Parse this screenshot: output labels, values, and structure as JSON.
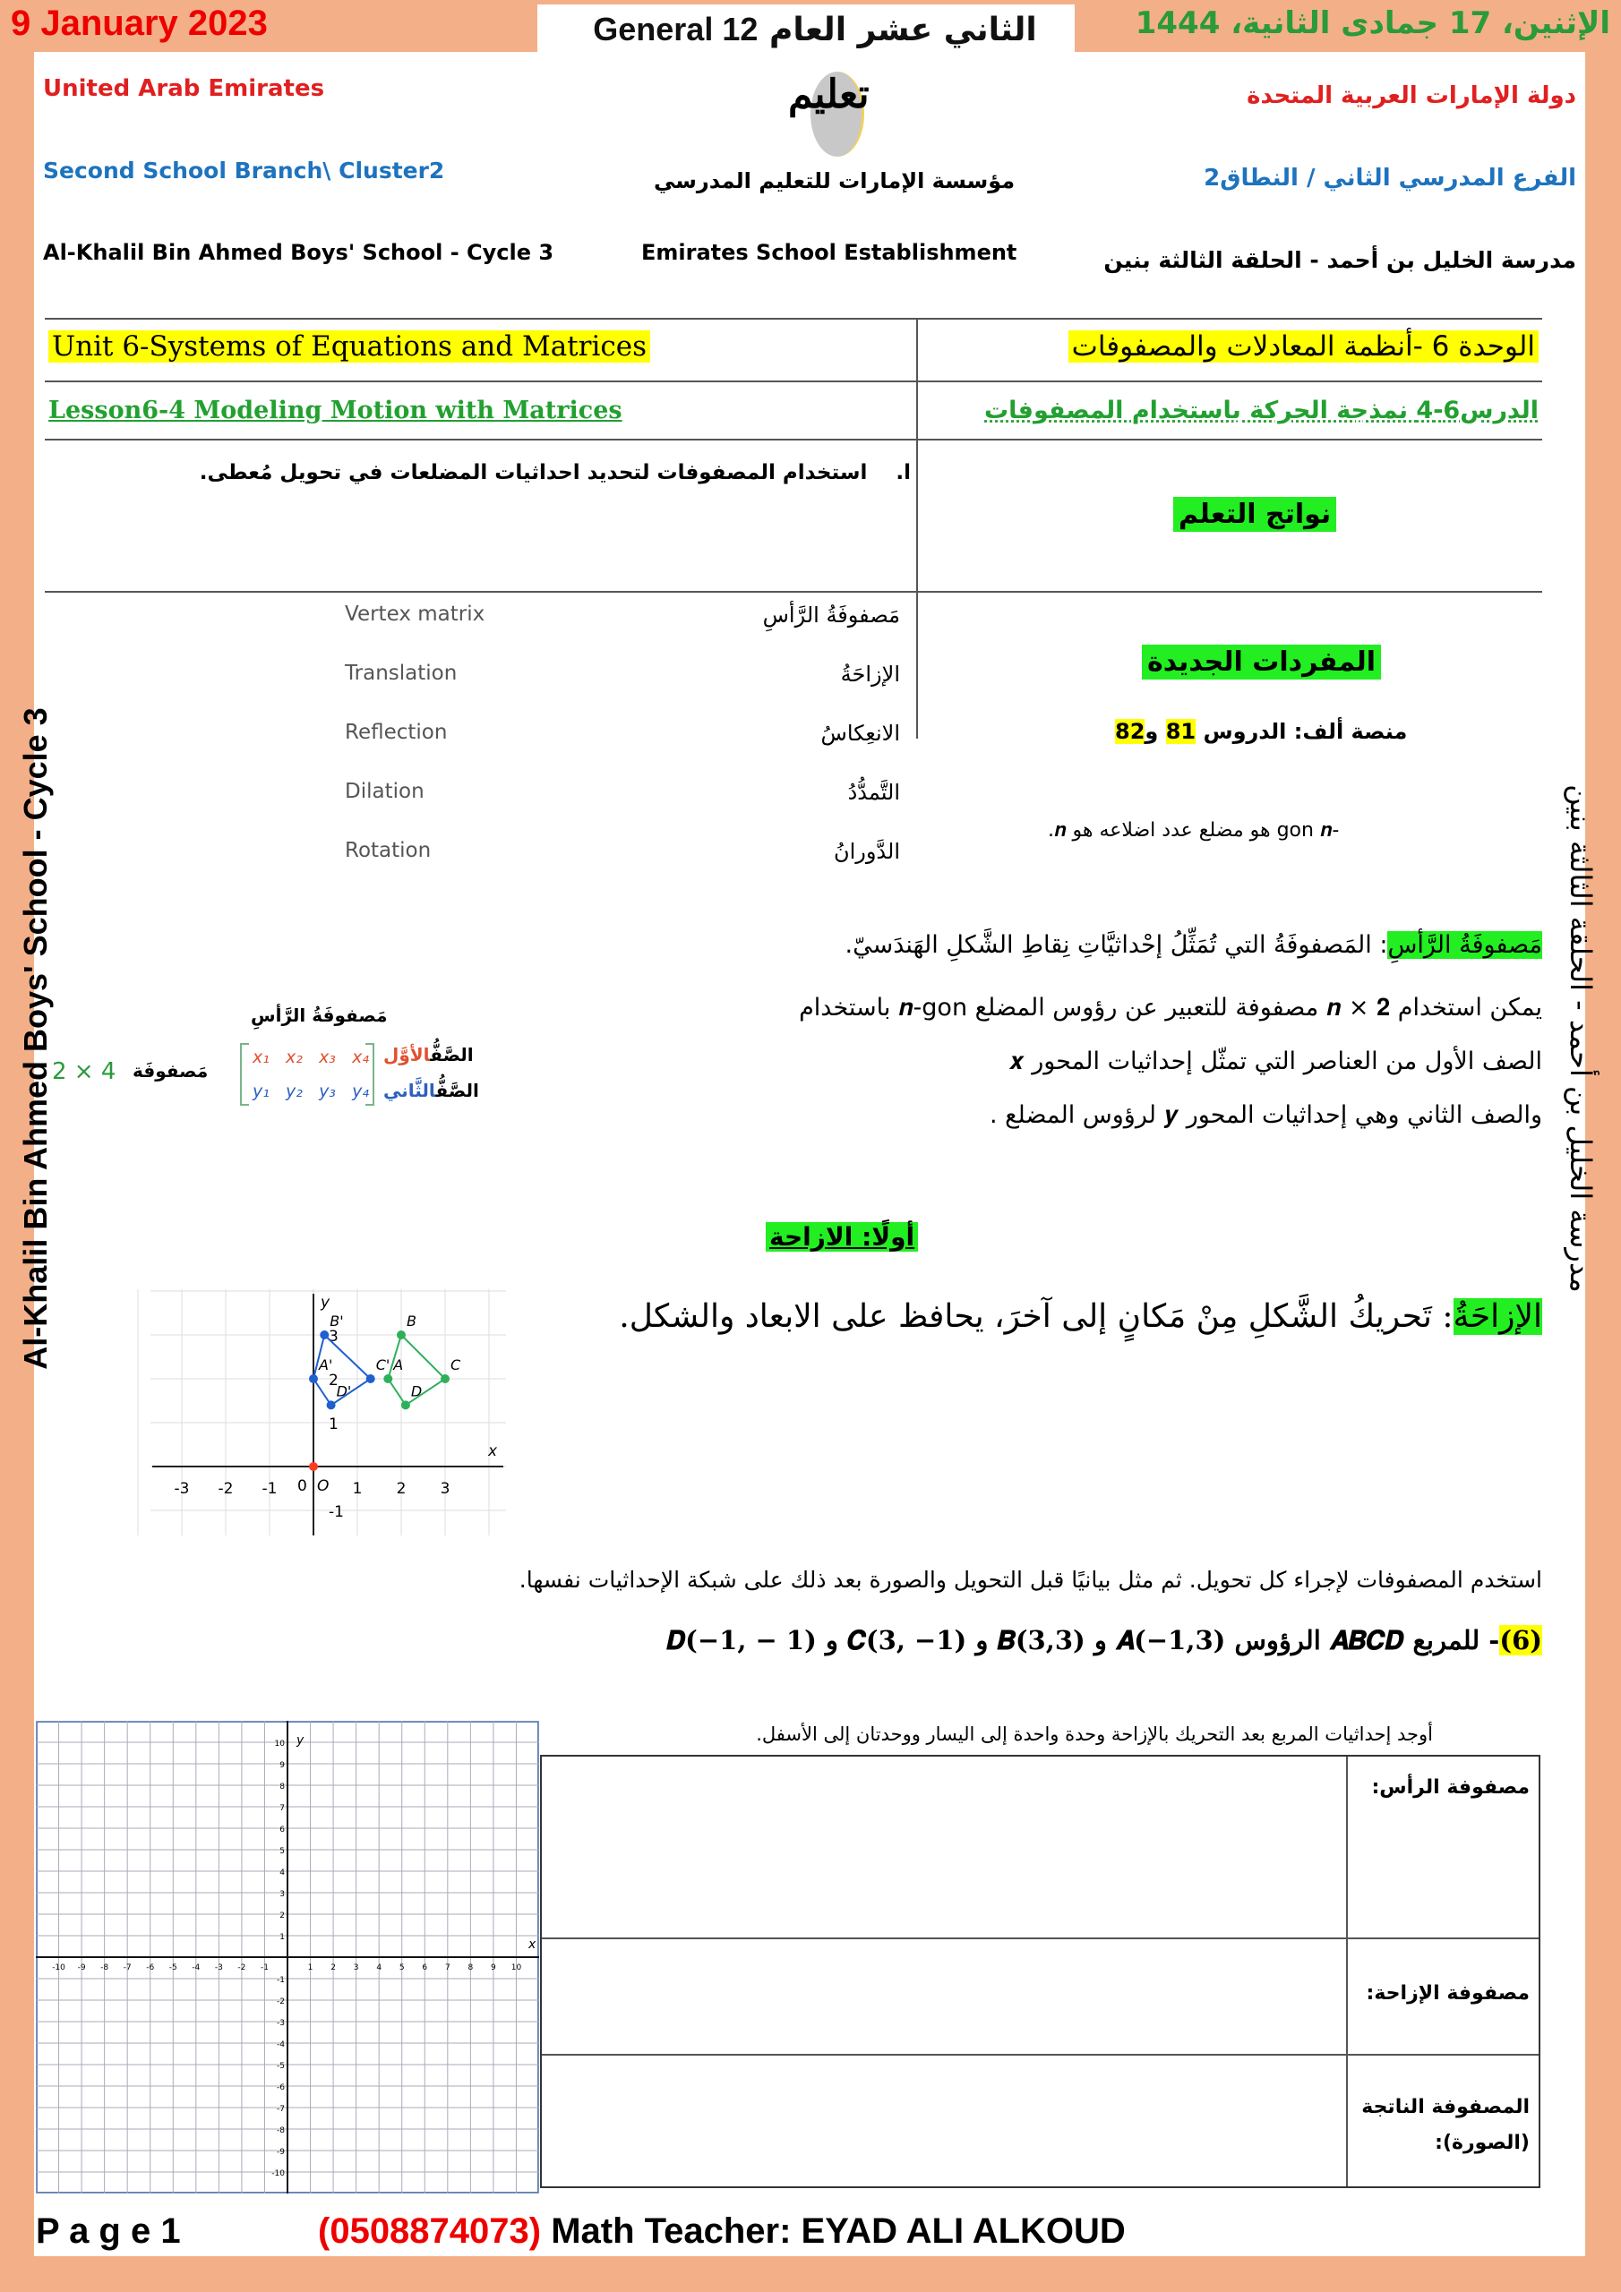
{
  "header": {
    "date_en": "9 January 2023",
    "grade": "12 General",
    "grade_ar": "الثاني عشر العام",
    "date_ar": "الإثنين، 17 جمادى الثانية، 1444",
    "country_en": "United Arab Emirates",
    "country_ar": "دولة الإمارات العربية المتحدة",
    "branch_en": "Second School Branch\\ Cluster2",
    "branch_ar": "الفرع المدرسي الثاني / النطاق2",
    "logo_text": "تعليم",
    "establishment_ar": "مؤسسة الإمارات للتعليم المدرسي",
    "school_en": "Al-Khalil Bin Ahmed Boys' School - Cycle 3",
    "establishment_en": "Emirates School Establishment",
    "school_ar": "مدرسة الخليل بن أحمد - الحلقة الثالثة بنين"
  },
  "side": {
    "left": "Al-Khalil Bin Ahmed Boys' School - Cycle 3",
    "right": "مدرسة الخليل بن أحمد - الحلقة الثالثة بنين"
  },
  "info_table": {
    "unit_en": "Unit 6-Systems of Equations and Matrices",
    "unit_ar": "الوحدة 6 -أنظمة المعادلات والمصفوفات",
    "lesson_en": "Lesson6-4 Modeling Motion with Matrices",
    "lesson_ar": "الدرس6-4 نمذجة الحركة باستخدام المصفوفات",
    "outcome_num": "ا.",
    "outcome": "استخدام المصفوفات لتحديد احداثيات المضلعات في تحويل مُعطى.",
    "outcomes_label": "نواتج التعلم",
    "vocab_label": "المفردات الجديدة",
    "platform_prefix": "منصة ألف: الدروس",
    "lesson_a": "81",
    "and": "و",
    "lesson_b": "82",
    "ngon": "-gon 𝒏 هو مضلع عدد اضلاعه هو 𝒏.",
    "vocab": [
      {
        "en": "Vertex matrix",
        "ar": "مَصفوفَةُ الرَّأسِ"
      },
      {
        "en": "Translation",
        "ar": "الإزاحَةُ"
      },
      {
        "en": "Reflection",
        "ar": "الانعِكاسُ"
      },
      {
        "en": "Dilation",
        "ar": "التَّمدُّدُ"
      },
      {
        "en": "Rotation",
        "ar": "الدَّورانُ"
      }
    ]
  },
  "vertex": {
    "term": "مَصفوفَةُ الرَّأسِ",
    "def": ": المَصفوفَةُ التي تُمَثِّلُ إحْداثيَّاتِ نِقاطِ الشَّكلِ الهَندَسيّ.",
    "line1": "يمكن استخدام 𝒏 × 𝟐 مصفوفة للتعبير عن رؤوس المضلع 𝒏-gon باستخدام",
    "line2": "الصف الأول من العناصر التي تمثّل إحداثيات المحور 𝒙",
    "line3": "والصف الثاني وهي إحداثيات المحور 𝒚 لرؤوس المضلع ."
  },
  "matrix": {
    "title": "مَصفوفَةُ الرَّأسِ",
    "row1_a": "الصَّفُّ",
    "row1_b": "الأوَّل",
    "row2_a": "الصَّفُّ",
    "row2_b": "الثَّاني",
    "size_label": "مَصفوفَة",
    "size": "2 × 4",
    "row1": [
      "x₁",
      "x₂",
      "x₃",
      "x₄"
    ],
    "row2": [
      "y₁",
      "y₂",
      "y₃",
      "y₄"
    ]
  },
  "translation": {
    "heading": "أولًا: الازاحة",
    "term": "الإزاحَةُ",
    "def": ": تَحريكُ الشَّكلِ مِنْ مَكانٍ إلى آخرَ، يحافظ على الابعاد والشكل."
  },
  "figure": {
    "x_ticks": [
      "-3",
      "-2",
      "-1",
      "1",
      "2",
      "3"
    ],
    "y_ticks": [
      "3",
      "2",
      "1",
      "-1"
    ],
    "origin": "O",
    "zero": "0",
    "x": "x",
    "y": "y",
    "original": {
      "A": [
        1.7,
        2
      ],
      "B": [
        2,
        3
      ],
      "C": [
        3,
        2
      ],
      "D": [
        2.1,
        1.4
      ]
    },
    "image": {
      "A'": [
        0,
        2
      ],
      "B'": [
        0.25,
        3
      ],
      "C'": [
        1.3,
        2
      ],
      "D'": [
        0.4,
        1.4
      ]
    },
    "colors": {
      "original": "#2eb05a",
      "image": "#1f5fcf",
      "origin": "#ff3b1f"
    }
  },
  "exercise": {
    "instruction": "استخدم المصفوفات لإجراء كل تحويل. ثم مثل بيانيًا قبل التحويل والصورة بعد ذلك على شبكة الإحداثيات نفسها.",
    "num": "(6)",
    "problem": "- للمربع 𝑨𝑩𝑪𝑫 الرؤوس 𝑨(−𝟏,𝟑) و 𝑩(𝟑,𝟑) و 𝑪(𝟑, −𝟏) و 𝑫(−𝟏, − 𝟏)",
    "task": "أوجد إحداثيات المربع بعد التحريك بالإزاحة وحدة واحدة إلى اليسار ووحدتان إلى الأسفل.",
    "rows": [
      "مصفوفة الرأس:",
      "مصفوفة الإزاحة:",
      "المصفوفة الناتجة (الصورة):"
    ]
  },
  "grid": {
    "x": "x",
    "y": "y",
    "min": -11,
    "max": 11,
    "labels": [
      "-10",
      "-9",
      "-8",
      "-7",
      "-6",
      "-5",
      "-4",
      "-3",
      "-2",
      "-1",
      "1",
      "2",
      "3",
      "4",
      "5",
      "6",
      "7",
      "8",
      "9",
      "10"
    ]
  },
  "footer": {
    "page": "P a g e 1",
    "phone": "(0508874073)",
    "teacher": " Math Teacher: EYAD ALI ALKOUD"
  }
}
